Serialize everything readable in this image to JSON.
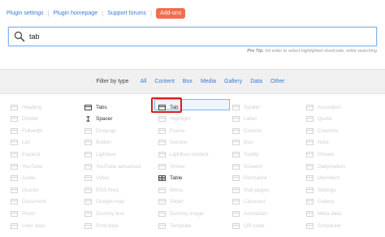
{
  "topnav": {
    "links": [
      "Plugin settings",
      "Plugin homepage",
      "Support forums"
    ],
    "addons_label": "Add-ons",
    "accent_color": "#f26d4f",
    "link_color": "#3a7bd5"
  },
  "search": {
    "value": "tab",
    "icon": "search-icon"
  },
  "protip": {
    "label": "Pro Tip:",
    "text": "Hit enter to select highlighted shortcode, while searching"
  },
  "filter": {
    "title": "Filter by type",
    "items": [
      "All",
      "Content",
      "Box",
      "Media",
      "Gallery",
      "Data",
      "Other"
    ]
  },
  "shortcodes": {
    "col1": [
      "Heading",
      "Divider",
      "Fullwidth",
      "List",
      "Expand",
      "YouTube",
      "Audio",
      "Guests",
      "Document",
      "Posts",
      "User data"
    ],
    "col2": [
      "Tabs",
      "Spacer",
      "Dropcap",
      "Button",
      "Lightbox",
      "YouTube advanced",
      "Video",
      "RSS feed",
      "Google map",
      "Dummy text",
      "Post data"
    ],
    "col3": [
      "Tab",
      "Highlight",
      "Frame",
      "Service",
      "Lightbox content",
      "Vimeo",
      "Table",
      "Menu",
      "Slider",
      "Dummy image",
      "Template"
    ],
    "col4": [
      "Spoiler",
      "Label",
      "Column",
      "Box",
      "Tooltip",
      "Screenr",
      "Permalink",
      "Sub pages",
      "Carousel",
      "Animation",
      "QR code"
    ],
    "col5": [
      "Accordion",
      "Quote",
      "Columns",
      "Note",
      "Private",
      "Dailymotion",
      "Members",
      "Siblings",
      "Gallery",
      "Meta data",
      "Scheduler"
    ],
    "matches": [
      "Tabs",
      "Spacer",
      "Tab",
      "Table"
    ]
  }
}
